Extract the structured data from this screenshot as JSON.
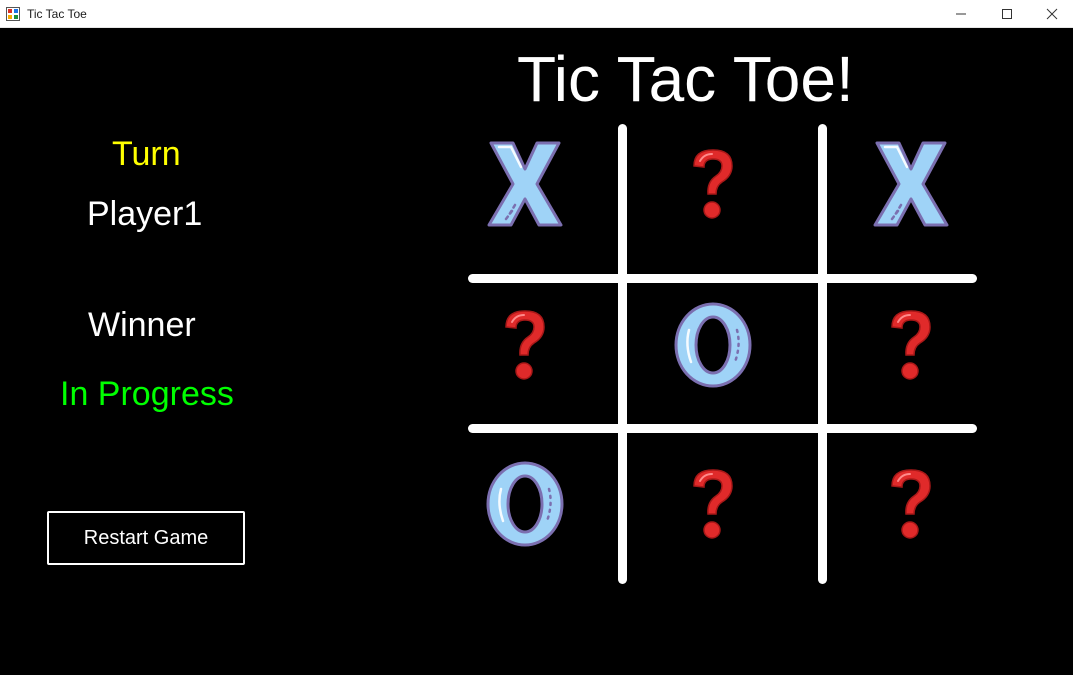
{
  "window": {
    "title": "Tic Tac Toe"
  },
  "game": {
    "title": "Tic Tac Toe!",
    "turn_label": "Turn",
    "turn_value": "Player1",
    "winner_label": "Winner",
    "winner_value": "In Progress",
    "restart_label": "Restart Game"
  },
  "board": {
    "cells": [
      "X",
      "?",
      "X",
      "?",
      "O",
      "?",
      "O",
      "?",
      "?"
    ]
  },
  "colors": {
    "turn_label": "#ffff00",
    "winner_value": "#00ff00",
    "mark_fill": "#9fd3f7",
    "mark_stroke": "#7b6fb0",
    "question_mark": "#e02a2a"
  }
}
